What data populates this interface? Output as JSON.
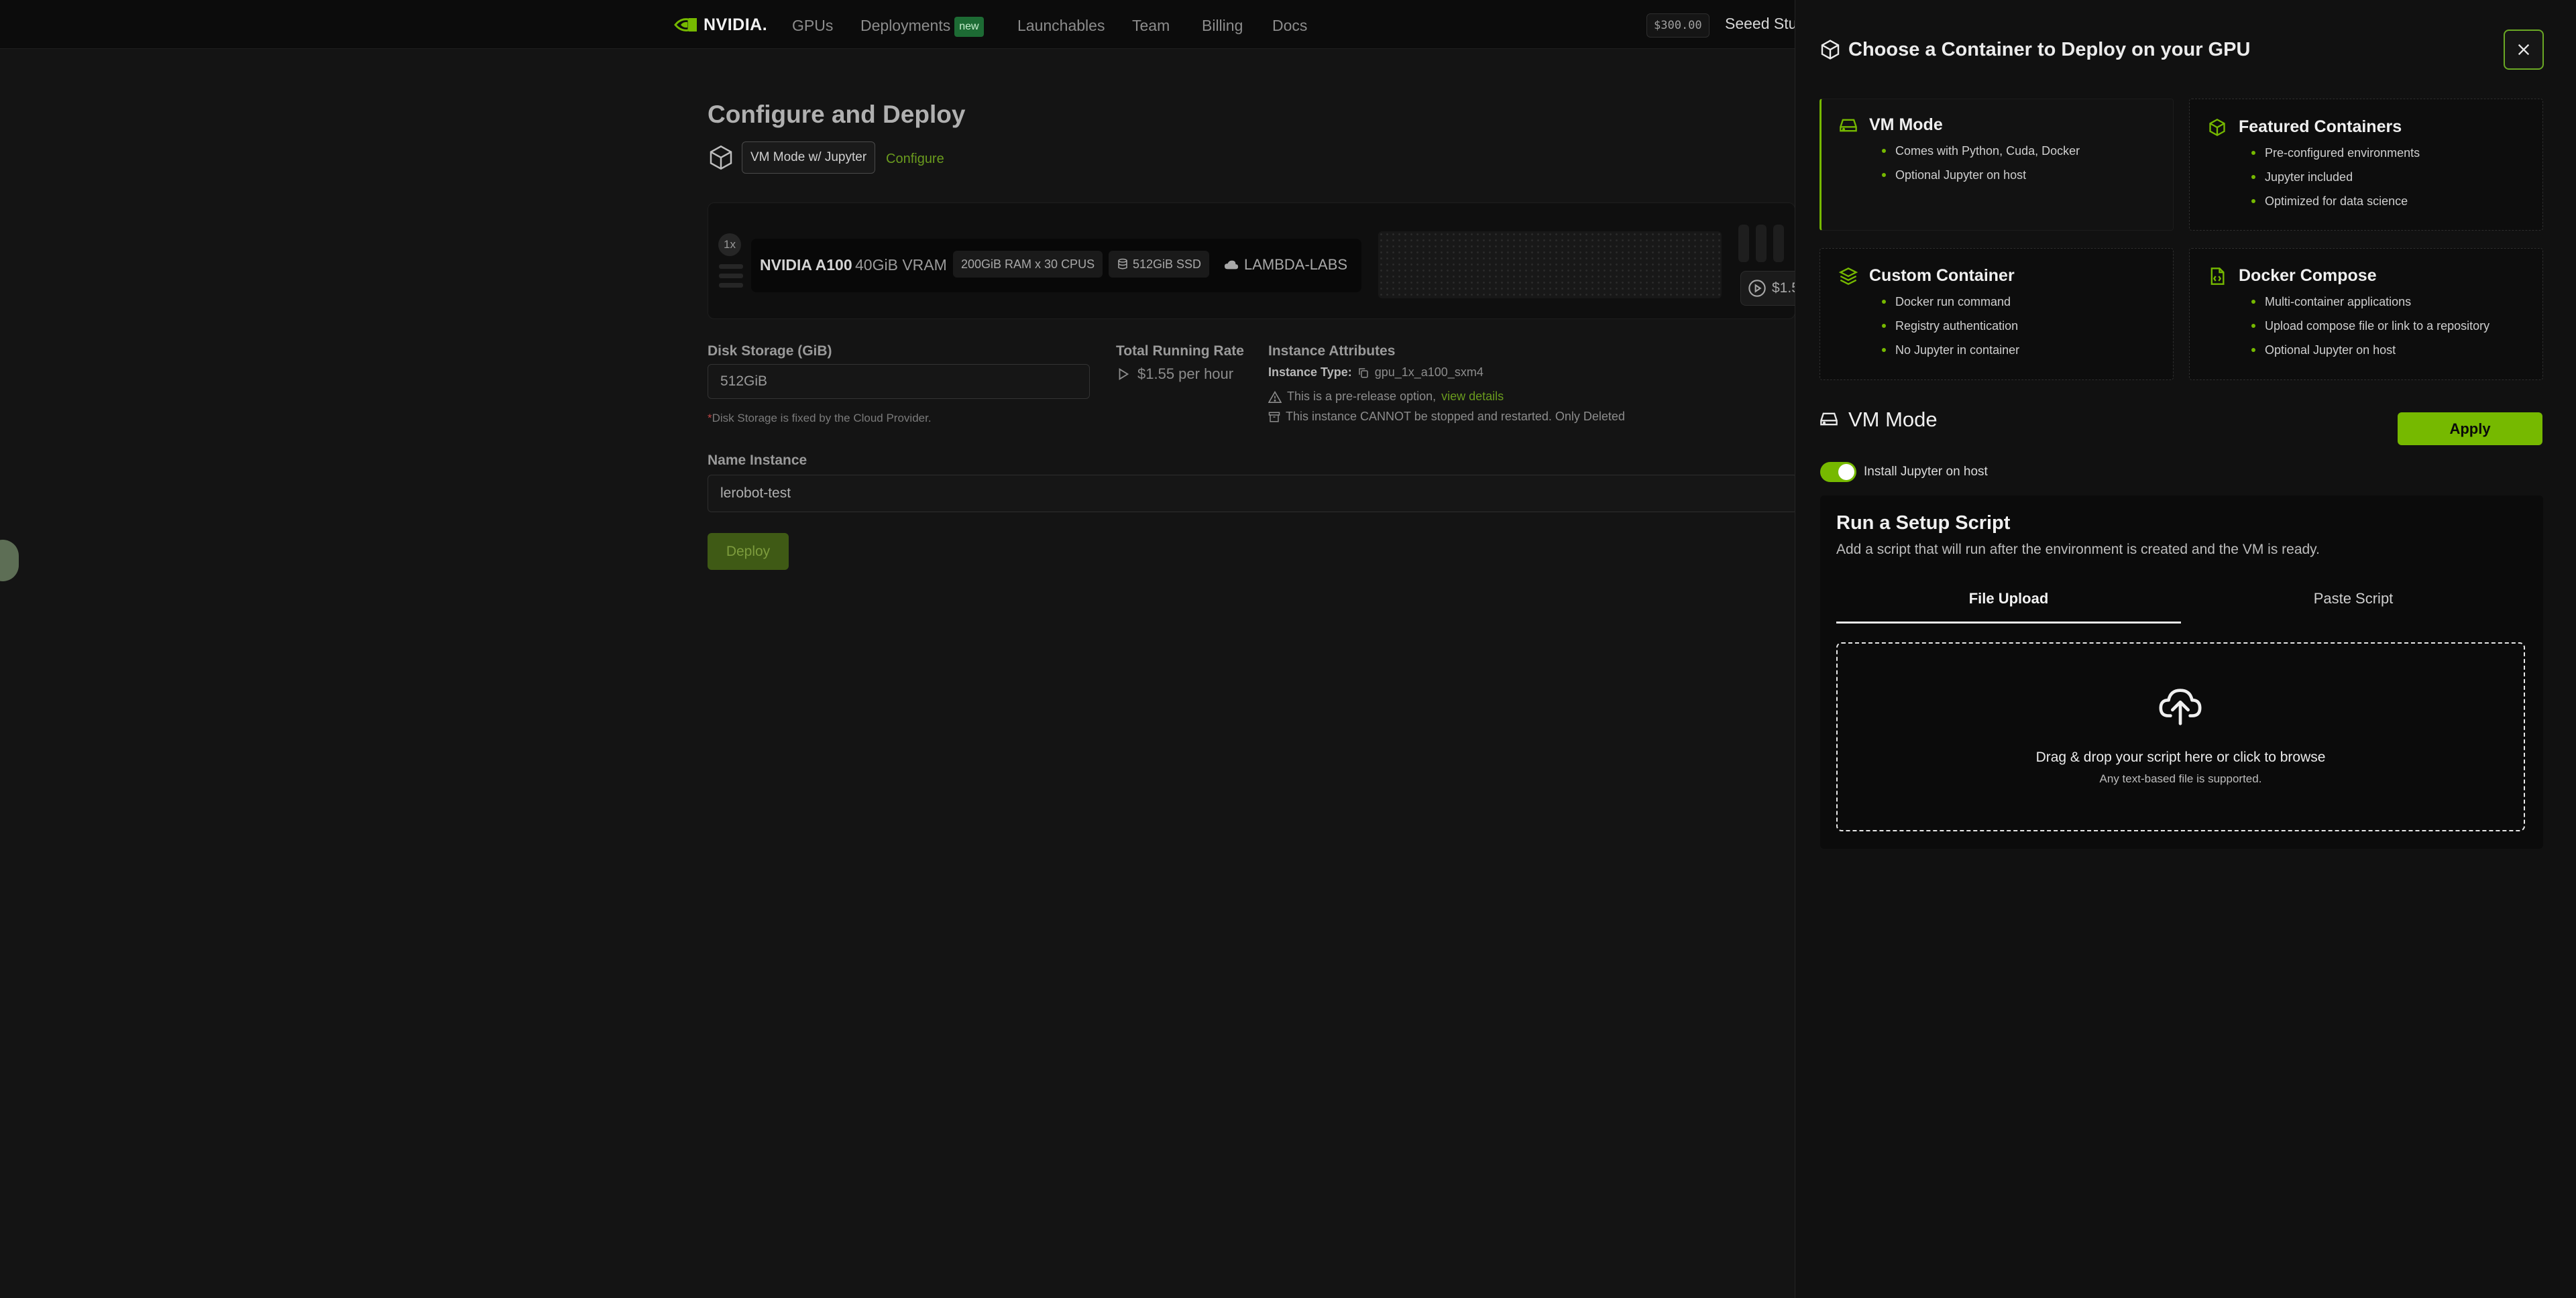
{
  "nav": {
    "brand": "NVIDIA.",
    "items": [
      "GPUs",
      "Deployments",
      "Launchables",
      "Team",
      "Billing",
      "Docs"
    ],
    "new_badge": "new",
    "credit": "$300.00",
    "org": "Seeed Stu"
  },
  "main": {
    "title": "Configure and Deploy",
    "mode_label": "VM Mode w/ Jupyter",
    "configure_link": "Configure",
    "gpu_count": "1x",
    "gpu_name": "NVIDIA A100",
    "gpu_vram": "40GiB VRAM",
    "ram_cpu": "200GiB RAM x 30 CPUS",
    "ssd": "512GiB SSD",
    "provider": "LAMBDA-LABS",
    "rate_pill": "$1.5",
    "disk_label": "Disk Storage (GiB)",
    "disk_value": "512GiB",
    "disk_note_star": "*",
    "disk_note": "Disk Storage is fixed by the Cloud Provider.",
    "rate_label": "Total Running Rate",
    "rate_value": "$1.55 per hour",
    "attributes_label": "Instance Attributes",
    "instance_type_label": "Instance Type:",
    "instance_type_value": "gpu_1x_a100_sxm4",
    "prerelease_text": "This is a pre-release option,",
    "view_details": "view details",
    "stop_warning": "This instance CANNOT be stopped and restarted. Only Deleted",
    "name_label": "Name Instance",
    "name_value": "lerobot-test",
    "deploy": "Deploy"
  },
  "drawer": {
    "title": "Choose a Container to Deploy on your GPU",
    "options": [
      {
        "title": "VM Mode",
        "icon": "hard-drive-icon",
        "bullets": [
          "Comes with Python, Cuda, Docker",
          "Optional Jupyter on host"
        ]
      },
      {
        "title": "Featured Containers",
        "icon": "box-icon",
        "bullets": [
          "Pre-configured environments",
          "Jupyter included",
          "Optimized for data science"
        ]
      },
      {
        "title": "Custom Container",
        "icon": "layers-icon",
        "bullets": [
          "Docker run command",
          "Registry authentication",
          "No Jupyter in container"
        ]
      },
      {
        "title": "Docker Compose",
        "icon": "file-code-icon",
        "bullets": [
          "Multi-container applications",
          "Upload compose file or link to a repository",
          "Optional Jupyter on host"
        ]
      }
    ],
    "section_title": "VM Mode",
    "apply": "Apply",
    "toggle_label": "Install Jupyter on host",
    "toggle_on": true,
    "script_title": "Run a Setup Script",
    "script_sub": "Add a script that will run after the environment is created and the VM is ready.",
    "tabs": [
      "File Upload",
      "Paste Script"
    ],
    "drop_main": "Drag & drop your script here or click to browse",
    "drop_sub": "Any text-based file is supported."
  },
  "colors": {
    "accent": "#76b900",
    "background": "#141414",
    "drawer": "#111111"
  }
}
